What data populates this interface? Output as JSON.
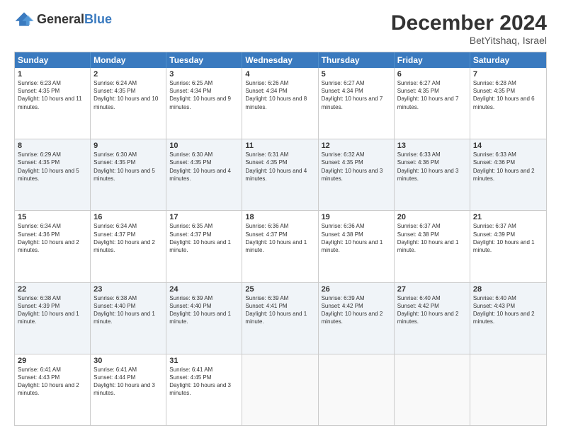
{
  "logo": {
    "general": "General",
    "blue": "Blue"
  },
  "title": "December 2024",
  "subtitle": "BetYitshaq, Israel",
  "days_of_week": [
    "Sunday",
    "Monday",
    "Tuesday",
    "Wednesday",
    "Thursday",
    "Friday",
    "Saturday"
  ],
  "weeks": [
    [
      {
        "day": "1",
        "sunrise": "6:23 AM",
        "sunset": "4:35 PM",
        "daylight": "10 hours and 11 minutes."
      },
      {
        "day": "2",
        "sunrise": "6:24 AM",
        "sunset": "4:35 PM",
        "daylight": "10 hours and 10 minutes."
      },
      {
        "day": "3",
        "sunrise": "6:25 AM",
        "sunset": "4:34 PM",
        "daylight": "10 hours and 9 minutes."
      },
      {
        "day": "4",
        "sunrise": "6:26 AM",
        "sunset": "4:34 PM",
        "daylight": "10 hours and 8 minutes."
      },
      {
        "day": "5",
        "sunrise": "6:27 AM",
        "sunset": "4:34 PM",
        "daylight": "10 hours and 7 minutes."
      },
      {
        "day": "6",
        "sunrise": "6:27 AM",
        "sunset": "4:35 PM",
        "daylight": "10 hours and 7 minutes."
      },
      {
        "day": "7",
        "sunrise": "6:28 AM",
        "sunset": "4:35 PM",
        "daylight": "10 hours and 6 minutes."
      }
    ],
    [
      {
        "day": "8",
        "sunrise": "6:29 AM",
        "sunset": "4:35 PM",
        "daylight": "10 hours and 5 minutes."
      },
      {
        "day": "9",
        "sunrise": "6:30 AM",
        "sunset": "4:35 PM",
        "daylight": "10 hours and 5 minutes."
      },
      {
        "day": "10",
        "sunrise": "6:30 AM",
        "sunset": "4:35 PM",
        "daylight": "10 hours and 4 minutes."
      },
      {
        "day": "11",
        "sunrise": "6:31 AM",
        "sunset": "4:35 PM",
        "daylight": "10 hours and 4 minutes."
      },
      {
        "day": "12",
        "sunrise": "6:32 AM",
        "sunset": "4:35 PM",
        "daylight": "10 hours and 3 minutes."
      },
      {
        "day": "13",
        "sunrise": "6:33 AM",
        "sunset": "4:36 PM",
        "daylight": "10 hours and 3 minutes."
      },
      {
        "day": "14",
        "sunrise": "6:33 AM",
        "sunset": "4:36 PM",
        "daylight": "10 hours and 2 minutes."
      }
    ],
    [
      {
        "day": "15",
        "sunrise": "6:34 AM",
        "sunset": "4:36 PM",
        "daylight": "10 hours and 2 minutes."
      },
      {
        "day": "16",
        "sunrise": "6:34 AM",
        "sunset": "4:37 PM",
        "daylight": "10 hours and 2 minutes."
      },
      {
        "day": "17",
        "sunrise": "6:35 AM",
        "sunset": "4:37 PM",
        "daylight": "10 hours and 1 minute."
      },
      {
        "day": "18",
        "sunrise": "6:36 AM",
        "sunset": "4:37 PM",
        "daylight": "10 hours and 1 minute."
      },
      {
        "day": "19",
        "sunrise": "6:36 AM",
        "sunset": "4:38 PM",
        "daylight": "10 hours and 1 minute."
      },
      {
        "day": "20",
        "sunrise": "6:37 AM",
        "sunset": "4:38 PM",
        "daylight": "10 hours and 1 minute."
      },
      {
        "day": "21",
        "sunrise": "6:37 AM",
        "sunset": "4:39 PM",
        "daylight": "10 hours and 1 minute."
      }
    ],
    [
      {
        "day": "22",
        "sunrise": "6:38 AM",
        "sunset": "4:39 PM",
        "daylight": "10 hours and 1 minute."
      },
      {
        "day": "23",
        "sunrise": "6:38 AM",
        "sunset": "4:40 PM",
        "daylight": "10 hours and 1 minute."
      },
      {
        "day": "24",
        "sunrise": "6:39 AM",
        "sunset": "4:40 PM",
        "daylight": "10 hours and 1 minute."
      },
      {
        "day": "25",
        "sunrise": "6:39 AM",
        "sunset": "4:41 PM",
        "daylight": "10 hours and 1 minute."
      },
      {
        "day": "26",
        "sunrise": "6:39 AM",
        "sunset": "4:42 PM",
        "daylight": "10 hours and 2 minutes."
      },
      {
        "day": "27",
        "sunrise": "6:40 AM",
        "sunset": "4:42 PM",
        "daylight": "10 hours and 2 minutes."
      },
      {
        "day": "28",
        "sunrise": "6:40 AM",
        "sunset": "4:43 PM",
        "daylight": "10 hours and 2 minutes."
      }
    ],
    [
      {
        "day": "29",
        "sunrise": "6:41 AM",
        "sunset": "4:43 PM",
        "daylight": "10 hours and 2 minutes."
      },
      {
        "day": "30",
        "sunrise": "6:41 AM",
        "sunset": "4:44 PM",
        "daylight": "10 hours and 3 minutes."
      },
      {
        "day": "31",
        "sunrise": "6:41 AM",
        "sunset": "4:45 PM",
        "daylight": "10 hours and 3 minutes."
      },
      null,
      null,
      null,
      null
    ]
  ]
}
